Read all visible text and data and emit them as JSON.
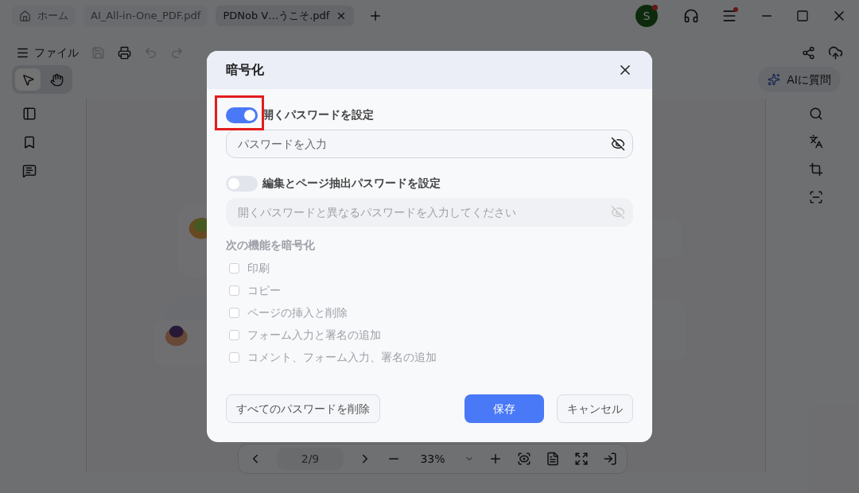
{
  "tabs": [
    {
      "label": "ホーム",
      "kind": "home",
      "selected": false
    },
    {
      "label": "AI_All-in-One_PDF.pdf",
      "kind": "file",
      "selected": false
    },
    {
      "label": "PDNob V…うこそ.pdf",
      "kind": "file",
      "selected": true
    }
  ],
  "account": {
    "initial": "S"
  },
  "tools": [
    {
      "kind": "select",
      "selected": true
    },
    {
      "kind": "hand",
      "selected": false
    }
  ],
  "file_menu": {
    "label": "ファイル"
  },
  "ai_button": {
    "label": "AIに質問"
  },
  "page_nav": {
    "page": "2/9",
    "zoom": "33%"
  },
  "dialog": {
    "title": "暗号化",
    "open_password": {
      "label": "開くパスワードを設定",
      "on": true,
      "placeholder": "パスワードを入力",
      "highlighted": true
    },
    "edit_password": {
      "label": "編集とページ抽出パスワードを設定",
      "on": false,
      "placeholder": "開くパスワードと異なるパスワードを入力してください"
    },
    "permissions": {
      "title": "次の機能を暗号化",
      "disabled": true,
      "items": [
        {
          "label": "印刷",
          "checked": false
        },
        {
          "label": "コピー",
          "checked": false
        },
        {
          "label": "ページの挿入と削除",
          "checked": false
        },
        {
          "label": "フォーム入力と署名の追加",
          "checked": false
        },
        {
          "label": "コメント、フォーム入力、署名の追加",
          "checked": false
        }
      ]
    },
    "buttons": [
      {
        "label": "すべてのパスワードを削除",
        "kind": "secondary"
      },
      {
        "label": "保存",
        "kind": "primary"
      },
      {
        "label": "キャンセル",
        "kind": "secondary"
      }
    ]
  }
}
